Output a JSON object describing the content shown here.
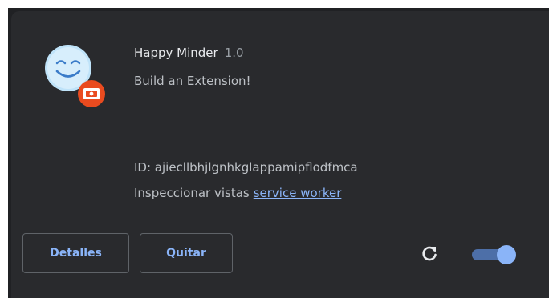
{
  "extension": {
    "name": "Happy Minder",
    "version": "1.0",
    "description": "Build an Extension!",
    "id_text": "ID: ajiecllbhjlgnhkglappamipflodfmca",
    "inspect_label": "Inspeccionar vistas",
    "inspect_link": "service worker",
    "icon": "happy-face-icon",
    "badge_icon": "unpacked-extension-badge-icon",
    "enabled": true
  },
  "actions": {
    "details_label": "Detalles",
    "remove_label": "Quitar",
    "reload_icon": "reload-icon"
  },
  "colors": {
    "card_bg": "#292a2d",
    "page_bg": "#202124",
    "accent": "#8ab4f8",
    "badge": "#ea4b1f"
  }
}
